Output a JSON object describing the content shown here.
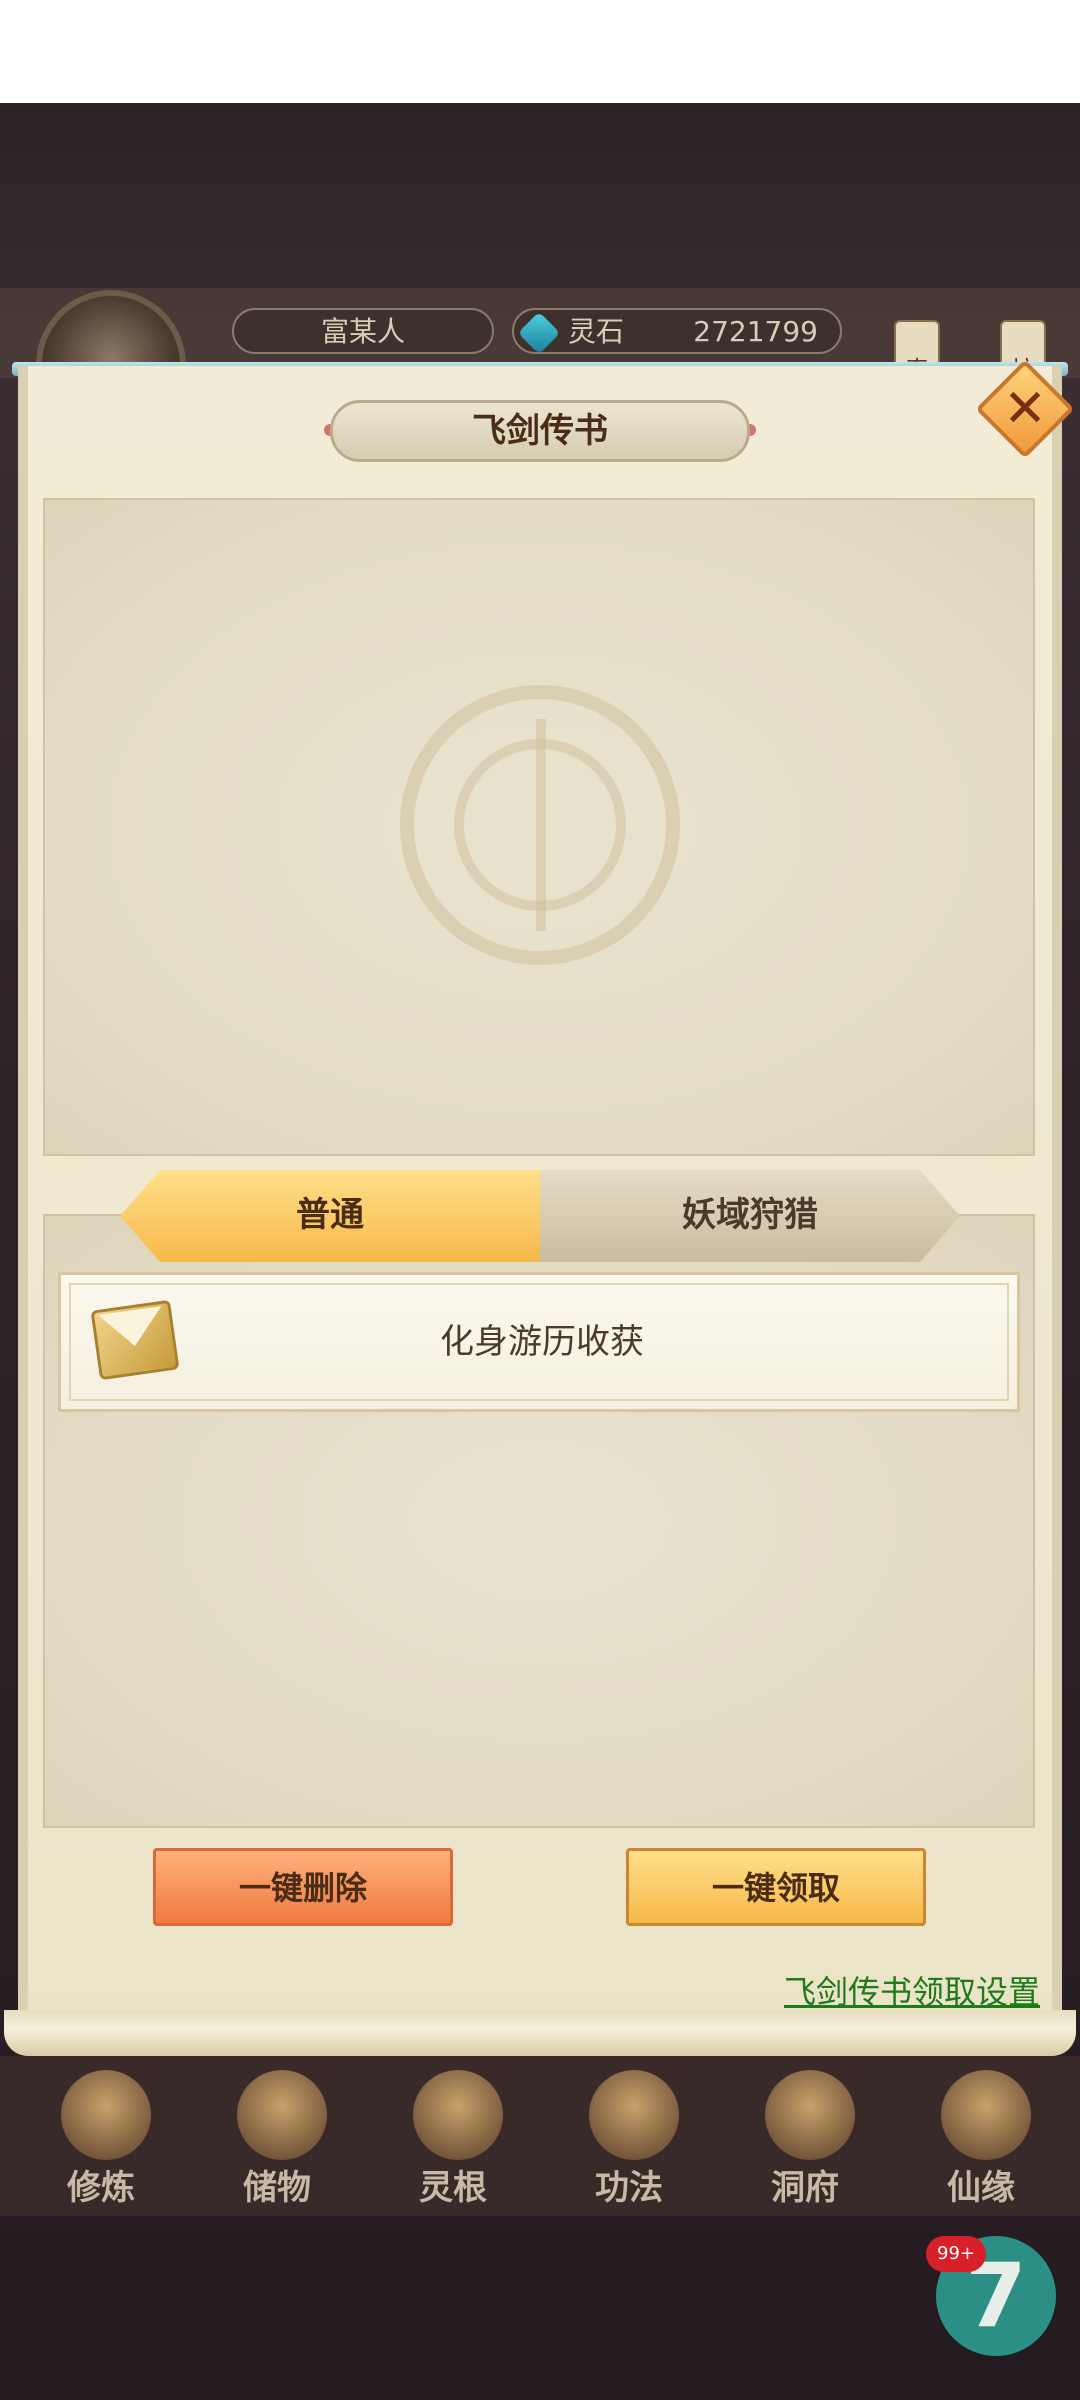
{
  "hud": {
    "player_name": "富某人",
    "currency_label": "灵石",
    "currency_value": "2721799",
    "side_tags": [
      "奇",
      "坊"
    ]
  },
  "dialog": {
    "title": "飞剑传书",
    "tabs": [
      {
        "label": "普通",
        "active": true
      },
      {
        "label": "妖域狩猎",
        "active": false
      }
    ],
    "mail_items": [
      {
        "title": "化身游历收获"
      }
    ],
    "buttons": {
      "delete_all": "一键删除",
      "claim_all": "一键领取"
    },
    "settings_link": "飞剑传书领取设置"
  },
  "bottom_nav": [
    {
      "label": "修炼"
    },
    {
      "label": "储物"
    },
    {
      "label": "灵根"
    },
    {
      "label": "功法"
    },
    {
      "label": "洞府"
    },
    {
      "label": "仙缘"
    }
  ],
  "floating": {
    "badge": "99+",
    "label": "7"
  }
}
